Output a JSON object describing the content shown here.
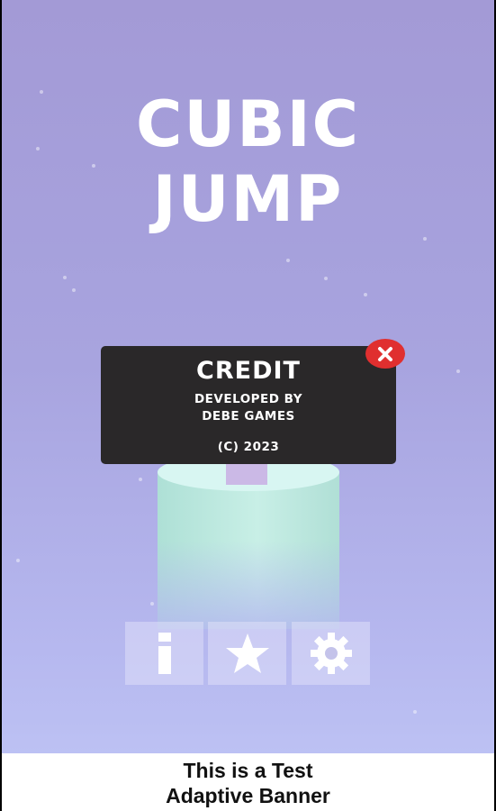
{
  "game": {
    "title_line1": "CUBIC",
    "title_line2": "JUMP"
  },
  "credit_dialog": {
    "heading": "CREDIT",
    "developed_by": "DEVELOPED BY",
    "developer": "DEBE GAMES",
    "copyright": "(C) 2023",
    "close_icon": "close-x-icon"
  },
  "buttons": [
    {
      "name": "info",
      "icon": "info-icon"
    },
    {
      "name": "rate",
      "icon": "star-icon"
    },
    {
      "name": "settings",
      "icon": "gear-icon"
    }
  ],
  "banner": {
    "line1": "This is a Test",
    "line2": "Adaptive Banner"
  },
  "colors": {
    "background_top": "#a39ad6",
    "background_bottom": "#c0c6f6",
    "dialog": "#2a2829",
    "close_button": "#e02f2f",
    "pillar": "#c8efe6",
    "cube": "#cbb9e6"
  }
}
